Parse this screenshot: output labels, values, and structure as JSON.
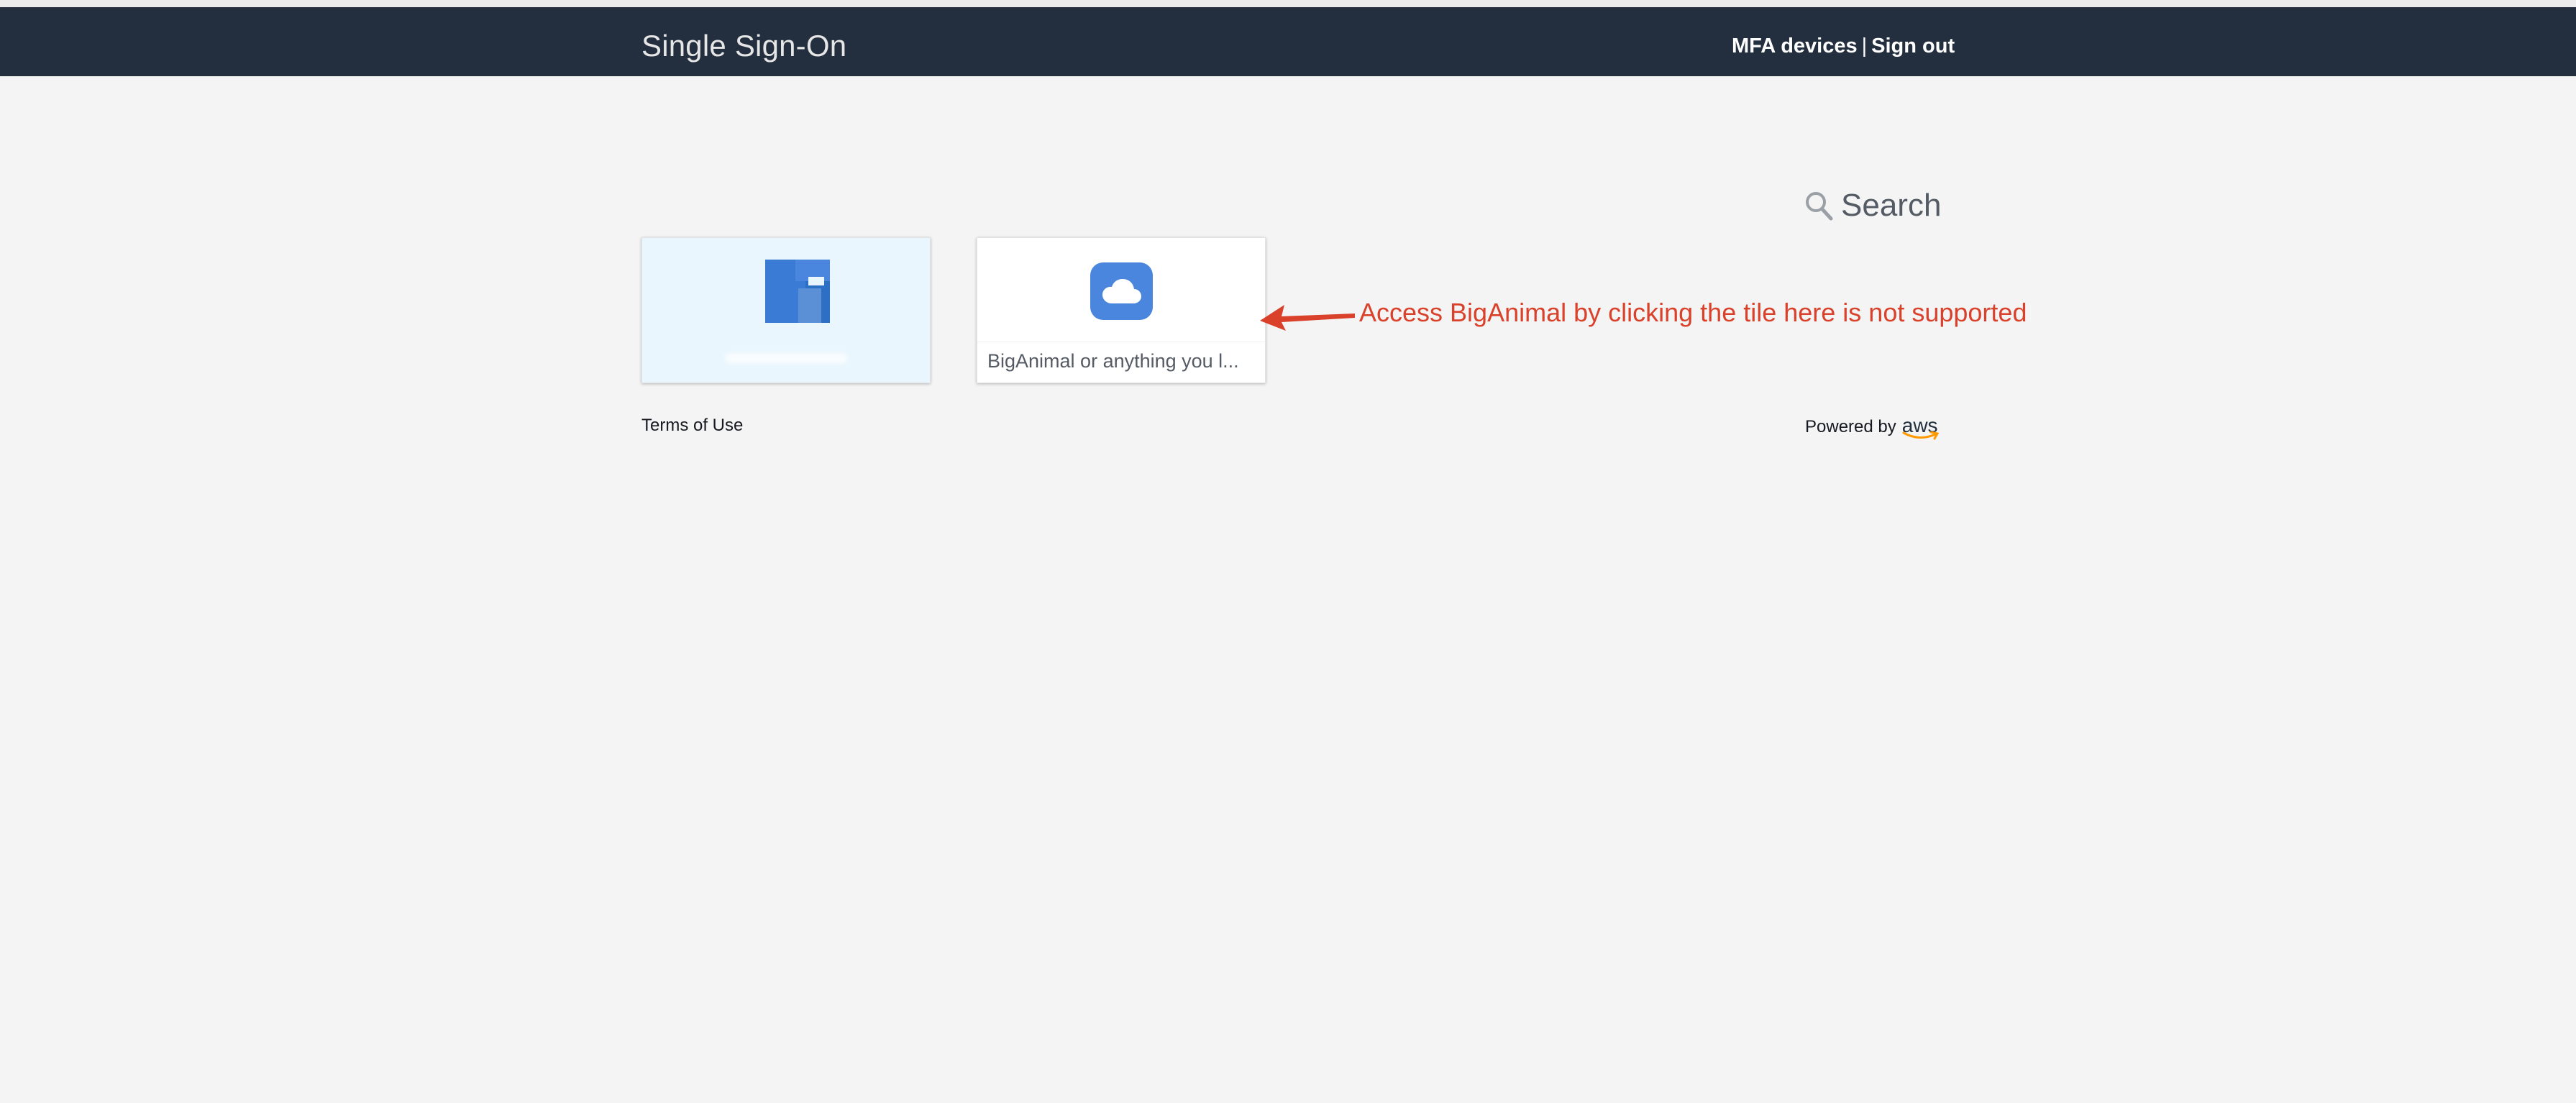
{
  "header": {
    "title": "Single Sign-On",
    "mfa_link": "MFA devices",
    "separator": "|",
    "signout_link": "Sign out"
  },
  "search": {
    "icon": "search-icon",
    "label": "Search"
  },
  "tiles": [
    {
      "icon": "app-logo-icon",
      "label": ""
    },
    {
      "icon": "cloud-icon",
      "label": "BigAnimal or anything you l..."
    }
  ],
  "annotation": {
    "text": "Access BigAnimal by clicking the tile here is not supported",
    "color": "#d9412b"
  },
  "footer": {
    "terms": "Terms of Use",
    "powered_by": "Powered by",
    "aws_logo_text": "aws"
  },
  "colors": {
    "header_bg": "#232f3e",
    "page_bg": "#f4f4f4",
    "accent_blue": "#4a86dd"
  }
}
